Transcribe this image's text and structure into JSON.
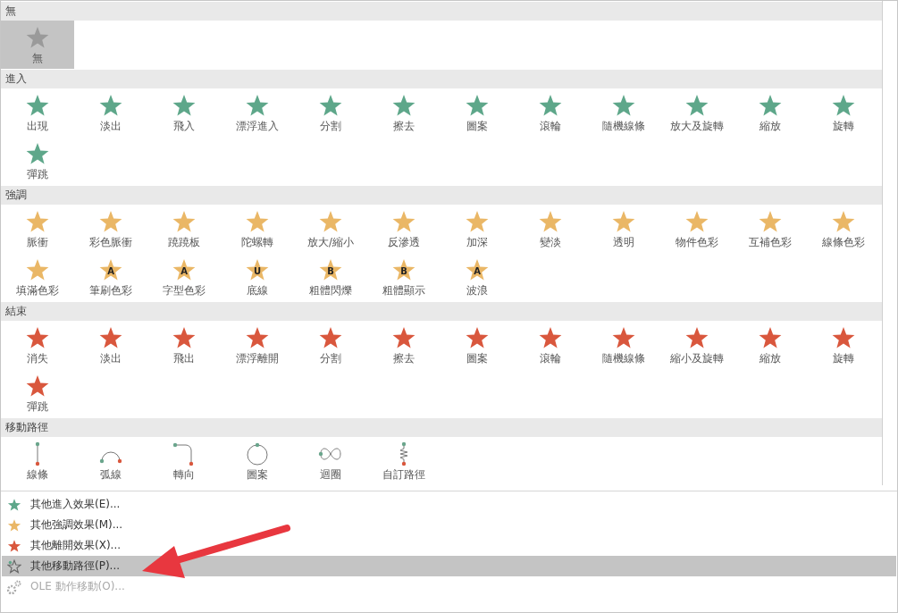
{
  "sections": [
    {
      "title": "無",
      "kind": "none",
      "items": [
        {
          "label": "無",
          "selected": true
        }
      ]
    },
    {
      "title": "進入",
      "kind": "entrance",
      "items": [
        {
          "label": "出現",
          "selected": false
        },
        {
          "label": "淡出",
          "selected": false
        },
        {
          "label": "飛入",
          "selected": false
        },
        {
          "label": "漂浮進入",
          "selected": false
        },
        {
          "label": "分割",
          "selected": false
        },
        {
          "label": "擦去",
          "selected": false
        },
        {
          "label": "圖案",
          "selected": false
        },
        {
          "label": "滾輪",
          "selected": false
        },
        {
          "label": "隨機線條",
          "selected": false
        },
        {
          "label": "放大及旋轉",
          "selected": false
        },
        {
          "label": "縮放",
          "selected": false
        },
        {
          "label": "旋轉",
          "selected": false
        },
        {
          "label": "彈跳",
          "selected": false
        }
      ]
    },
    {
      "title": "強調",
      "kind": "emphasis",
      "items": [
        {
          "label": "脈衝",
          "selected": false
        },
        {
          "label": "彩色脈衝",
          "selected": false
        },
        {
          "label": "蹺蹺板",
          "selected": false
        },
        {
          "label": "陀螺轉",
          "selected": false
        },
        {
          "label": "放大/縮小",
          "selected": false
        },
        {
          "label": "反滲透",
          "selected": false
        },
        {
          "label": "加深",
          "selected": false
        },
        {
          "label": "變淡",
          "selected": false
        },
        {
          "label": "透明",
          "selected": false
        },
        {
          "label": "物件色彩",
          "selected": false
        },
        {
          "label": "互補色彩",
          "selected": false
        },
        {
          "label": "線條色彩",
          "selected": false
        },
        {
          "label": "填滿色彩",
          "selected": false
        },
        {
          "label": "筆刷色彩",
          "selected": false,
          "glyph": "A"
        },
        {
          "label": "字型色彩",
          "selected": false,
          "glyph": "A"
        },
        {
          "label": "底線",
          "selected": false,
          "glyph": "U"
        },
        {
          "label": "粗體閃爍",
          "selected": false,
          "glyph": "B"
        },
        {
          "label": "粗體顯示",
          "selected": false,
          "glyph": "B"
        },
        {
          "label": "波浪",
          "selected": false,
          "glyph": "A"
        }
      ]
    },
    {
      "title": "結束",
      "kind": "exit",
      "items": [
        {
          "label": "消失",
          "selected": false
        },
        {
          "label": "淡出",
          "selected": false
        },
        {
          "label": "飛出",
          "selected": false
        },
        {
          "label": "漂浮離開",
          "selected": false
        },
        {
          "label": "分割",
          "selected": false
        },
        {
          "label": "擦去",
          "selected": false
        },
        {
          "label": "圖案",
          "selected": false
        },
        {
          "label": "滾輪",
          "selected": false
        },
        {
          "label": "隨機線條",
          "selected": false
        },
        {
          "label": "縮小及旋轉",
          "selected": false
        },
        {
          "label": "縮放",
          "selected": false
        },
        {
          "label": "旋轉",
          "selected": false
        },
        {
          "label": "彈跳",
          "selected": false
        }
      ]
    },
    {
      "title": "移動路徑",
      "kind": "path",
      "items": [
        {
          "label": "線條",
          "selected": false
        },
        {
          "label": "弧線",
          "selected": false
        },
        {
          "label": "轉向",
          "selected": false
        },
        {
          "label": "圖案",
          "selected": false
        },
        {
          "label": "迴圈",
          "selected": false
        },
        {
          "label": "自訂路徑",
          "selected": false
        }
      ]
    }
  ],
  "menu": [
    {
      "label": "其他進入效果(E)...",
      "kind": "entrance",
      "selected": false,
      "disabled": false
    },
    {
      "label": "其他強調效果(M)...",
      "kind": "emphasis",
      "selected": false,
      "disabled": false
    },
    {
      "label": "其他離開效果(X)...",
      "kind": "exit",
      "selected": false,
      "disabled": false
    },
    {
      "label": "其他移動路徑(P)...",
      "kind": "path",
      "selected": true,
      "disabled": false
    },
    {
      "label": "OLE 動作移動(O)...",
      "kind": "ole",
      "selected": false,
      "disabled": true
    }
  ]
}
